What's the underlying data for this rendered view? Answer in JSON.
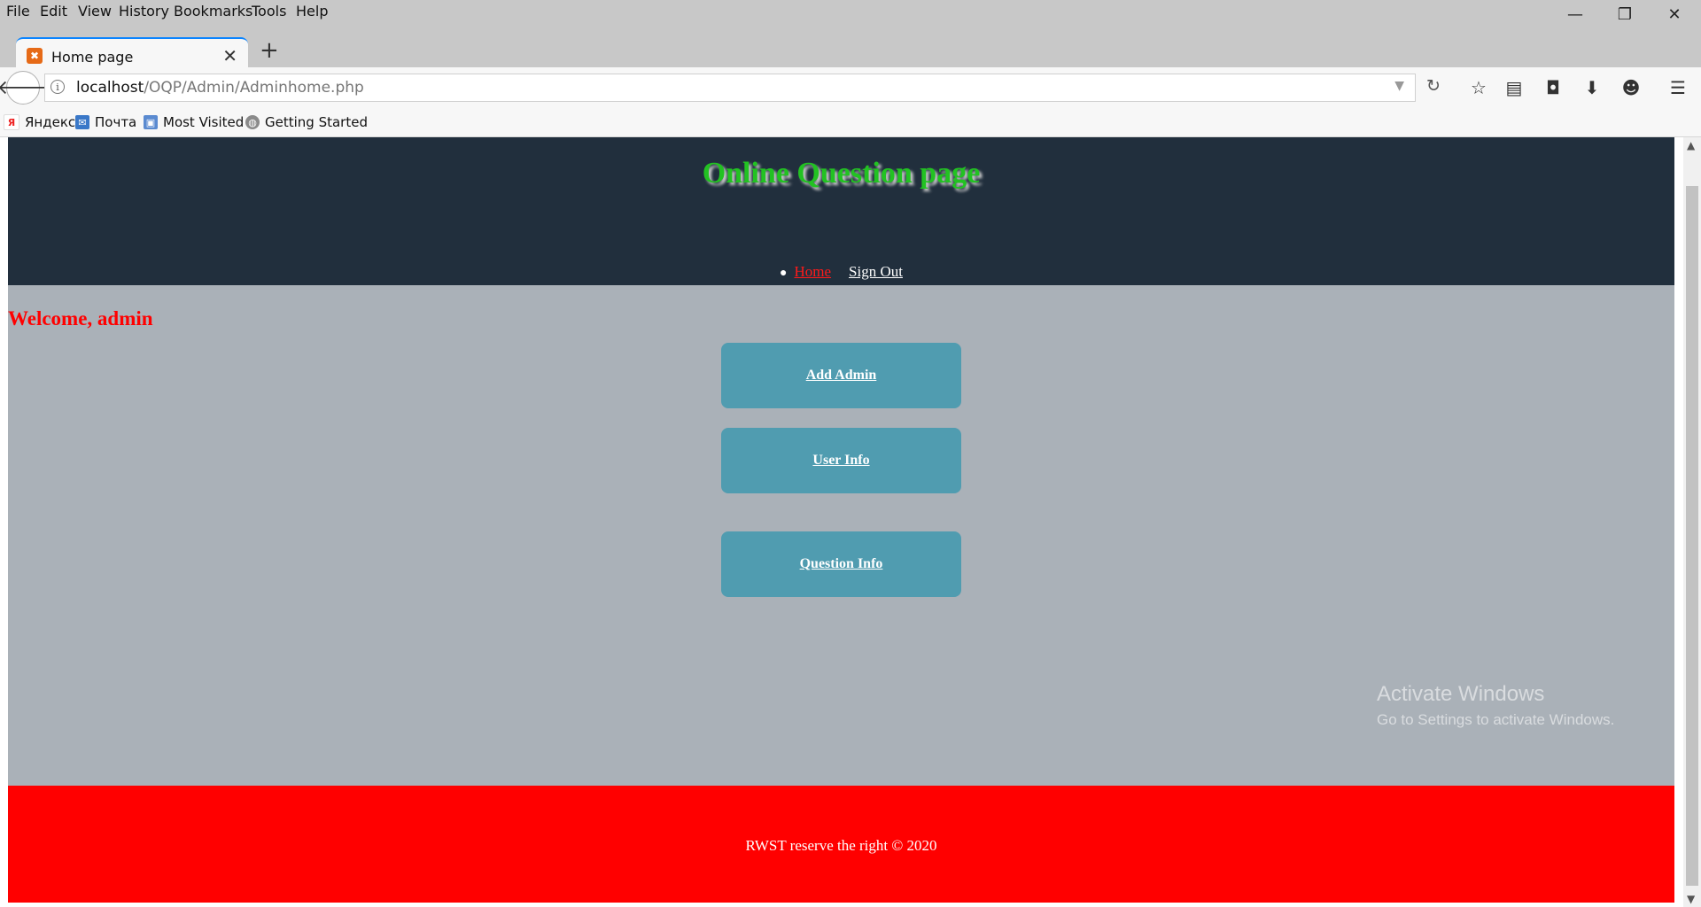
{
  "menu": [
    "File",
    "Edit",
    "View",
    "History",
    "Bookmarks",
    "Tools",
    "Help"
  ],
  "window_controls": {
    "minimize": "—",
    "restore": "❐",
    "close": "✕"
  },
  "tab": {
    "title": "Home page",
    "close": "✕",
    "favicon": "xampp-icon"
  },
  "newtab_label": "+",
  "url": {
    "host": "localhost",
    "path": "/OQP/Admin/Adminhome.php"
  },
  "toolbar_icons": [
    "star-icon",
    "reader-icon",
    "pocket-icon",
    "download-icon",
    "emoji-icon",
    "menu-icon"
  ],
  "bookmarks": [
    "Яндекс",
    "Почта",
    "Most Visited",
    "Getting Started"
  ],
  "page": {
    "title": "Online Question page",
    "nav": {
      "home": "Home",
      "signout": "Sign Out"
    },
    "welcome": "Welcome, admin",
    "buttons": {
      "add_admin": "Add Admin",
      "user_info": "User Info",
      "question_info": "Question Info"
    },
    "footer": "RWST reserve the right © 2020"
  },
  "watermark": {
    "title": "Activate Windows",
    "subtitle": "Go to Settings to activate Windows."
  },
  "colors": {
    "header_bg": "#212f3d",
    "title_green": "#22c222",
    "main_bg": "#aab1b8",
    "button_bg": "#509cb0",
    "welcome_red": "#ff0000",
    "footer_bg": "#ff0000"
  }
}
